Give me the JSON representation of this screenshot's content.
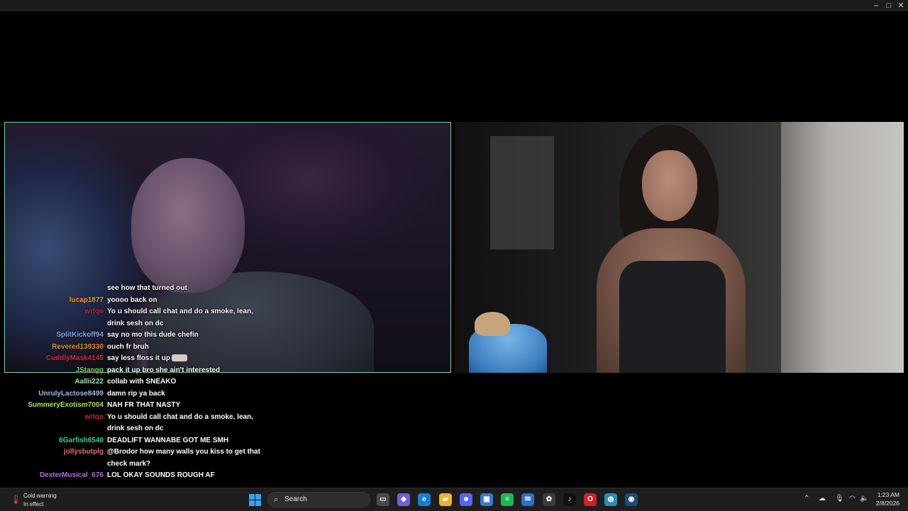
{
  "window": {
    "controls": [
      "–",
      "□",
      "✕"
    ]
  },
  "chat": {
    "messages": [
      {
        "user": "",
        "user_color": "#cccccc",
        "text": "see how that turned out",
        "emote": false
      },
      {
        "user": "lucap1877",
        "user_color": "#f0a030",
        "text": "yoooo back on",
        "emote": false
      },
      {
        "user": "wrlqo",
        "user_color": "#c0253d",
        "text": "Yo u should call chat and do a smoke, lean,",
        "emote": false
      },
      {
        "user": "",
        "user_color": "#cccccc",
        "text": "drink sesh on dc",
        "emote": false
      },
      {
        "user": "SplitKickoff94",
        "user_color": "#7aa6e0",
        "text": "say no mo this dude chefin",
        "emote": false
      },
      {
        "user": "Revered139330",
        "user_color": "#e88a2a",
        "text": "ouch fr bruh",
        "emote": false
      },
      {
        "user": "CuddlyMask4145",
        "user_color": "#d22e2e",
        "text": "say less floss it up",
        "emote": true
      },
      {
        "user": "JStangg",
        "user_color": "#79d36a",
        "text": "pack it up bro she ain't interested",
        "emote": false
      },
      {
        "user": "Aallii222",
        "user_color": "#9ee0b0",
        "text": "collab with SNEAKO",
        "emote": false
      },
      {
        "user": "UnrulyLactose8499",
        "user_color": "#9fb8e8",
        "text": "damn rip ya back",
        "emote": false
      },
      {
        "user": "SummeryExotism7004",
        "user_color": "#a8e060",
        "text": "NAH FR THAT NASTY",
        "emote": false
      },
      {
        "user": "wrlqo",
        "user_color": "#c0253d",
        "text": "Yo u should call chat and do a smoke, lean,",
        "emote": false
      },
      {
        "user": "",
        "user_color": "#cccccc",
        "text": "drink sesh on dc",
        "emote": false
      },
      {
        "user": "6Garfish6540",
        "user_color": "#3fcf9a",
        "text": "DEADLIFT WANNABE GOT ME SMH",
        "emote": false
      },
      {
        "user": "jollysbutplg",
        "user_color": "#e06a7a",
        "text": "@Brodor how many walls you kiss to get that",
        "emote": false
      },
      {
        "user": "",
        "user_color": "#cccccc",
        "text": "check mark?",
        "emote": false
      },
      {
        "user": "DexterMusical_676",
        "user_color": "#b86ae0",
        "text": "LOL OKAY SOUNDS ROUGH AF",
        "emote": false
      }
    ]
  },
  "taskbar": {
    "weather_line1": "Cold warning",
    "weather_line2": "In effect",
    "search_placeholder": "Search",
    "apps": [
      {
        "name": "task-view",
        "glyph": "▭",
        "color": "#4a4a4a"
      },
      {
        "name": "copilot",
        "glyph": "◆",
        "color": "#7a5ae0"
      },
      {
        "name": "edge",
        "glyph": "e",
        "color": "#1a7fd4"
      },
      {
        "name": "file-explorer",
        "glyph": "▰",
        "color": "#e8b530"
      },
      {
        "name": "discord",
        "glyph": "☻",
        "color": "#5865f2"
      },
      {
        "name": "microsoft-store",
        "glyph": "▦",
        "color": "#3a7ad0"
      },
      {
        "name": "spotify",
        "glyph": "≡",
        "color": "#1db954"
      },
      {
        "name": "mail",
        "glyph": "✉",
        "color": "#2a6fd0"
      },
      {
        "name": "chatgpt",
        "glyph": "✿",
        "color": "#3c3c3c"
      },
      {
        "name": "tiktok",
        "glyph": "♪",
        "color": "#111111"
      },
      {
        "name": "opera",
        "glyph": "O",
        "color": "#d0202e"
      },
      {
        "name": "globe",
        "glyph": "◍",
        "color": "#2a8fb0"
      },
      {
        "name": "steam",
        "glyph": "◉",
        "color": "#1b4d7a"
      }
    ],
    "clock_time": "1:23 AM",
    "clock_date": "2/8/2026"
  }
}
